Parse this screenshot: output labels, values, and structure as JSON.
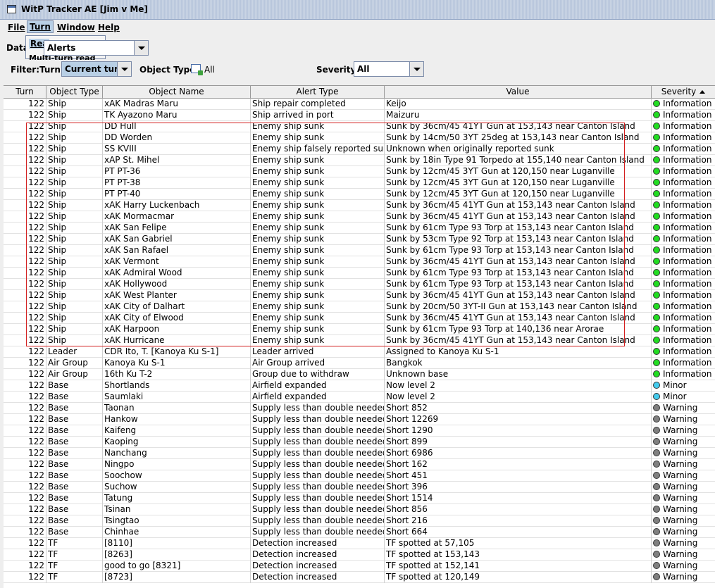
{
  "window": {
    "title": "WitP Tracker AE [Jim v Me]"
  },
  "menu": {
    "file": "File",
    "turn": "Turn",
    "window": "Window",
    "help": "Help"
  },
  "turn_menu": {
    "item1": "Rea",
    "item2": "Multi-turn read"
  },
  "toolbar": {
    "data_label": "Data",
    "data_value": "Alerts",
    "filter_label": "Filter:",
    "turn_label": "Turn:",
    "turn_value": "Current turn",
    "object_type_label": "Object Type:",
    "object_type_value": "All",
    "severity_label": "Severity:",
    "severity_value": "All"
  },
  "colors": {
    "information": "#22dd22",
    "minor": "#44ccee",
    "warning": "#808080",
    "highlight_box": "#d32020"
  },
  "table": {
    "columns": [
      "Turn",
      "Object Type",
      "Object Name",
      "Alert Type",
      "Value",
      "Severity"
    ],
    "rows": [
      {
        "turn": "122",
        "type": "Ship",
        "name": "xAK Madras Maru",
        "alert": "Ship repair completed",
        "value": "Keijo",
        "severity": "Information"
      },
      {
        "turn": "122",
        "type": "Ship",
        "name": "TK Ayazono Maru",
        "alert": "Ship arrived in port",
        "value": "Maizuru",
        "severity": "Information"
      },
      {
        "turn": "122",
        "type": "Ship",
        "name": "DD Hull",
        "alert": "Enemy ship sunk",
        "value": "Sunk by 36cm/45 41YT Gun at 153,143 near Canton Island",
        "severity": "Information"
      },
      {
        "turn": "122",
        "type": "Ship",
        "name": "DD Worden",
        "alert": "Enemy ship sunk",
        "value": "Sunk by 14cm/50 3YT 25deg at 153,143 near Canton Island",
        "severity": "Information"
      },
      {
        "turn": "122",
        "type": "Ship",
        "name": "SS KVIII",
        "alert": "Enemy ship falsely reported sunk",
        "value": "Unknown when originally reported sunk",
        "severity": "Information"
      },
      {
        "turn": "122",
        "type": "Ship",
        "name": "xAP St. Mihel",
        "alert": "Enemy ship sunk",
        "value": "Sunk by 18in Type 91 Torpedo at 155,140 near Canton Island",
        "severity": "Information"
      },
      {
        "turn": "122",
        "type": "Ship",
        "name": "PT PT-36",
        "alert": "Enemy ship sunk",
        "value": "Sunk by 12cm/45 3YT Gun at 120,150 near Luganville",
        "severity": "Information"
      },
      {
        "turn": "122",
        "type": "Ship",
        "name": "PT PT-38",
        "alert": "Enemy ship sunk",
        "value": "Sunk by 12cm/45 3YT Gun at 120,150 near Luganville",
        "severity": "Information"
      },
      {
        "turn": "122",
        "type": "Ship",
        "name": "PT PT-40",
        "alert": "Enemy ship sunk",
        "value": "Sunk by 12cm/45 3YT Gun at 120,150 near Luganville",
        "severity": "Information"
      },
      {
        "turn": "122",
        "type": "Ship",
        "name": "xAK Harry Luckenbach",
        "alert": "Enemy ship sunk",
        "value": "Sunk by 36cm/45 41YT Gun at 153,143 near Canton Island",
        "severity": "Information"
      },
      {
        "turn": "122",
        "type": "Ship",
        "name": "xAK Mormacmar",
        "alert": "Enemy ship sunk",
        "value": "Sunk by 36cm/45 41YT Gun at 153,143 near Canton Island",
        "severity": "Information"
      },
      {
        "turn": "122",
        "type": "Ship",
        "name": "xAK San Felipe",
        "alert": "Enemy ship sunk",
        "value": "Sunk by 61cm Type 93 Torp at 153,143 near Canton Island",
        "severity": "Information"
      },
      {
        "turn": "122",
        "type": "Ship",
        "name": "xAK San Gabriel",
        "alert": "Enemy ship sunk",
        "value": "Sunk by 53cm Type 92 Torp at 153,143 near Canton Island",
        "severity": "Information"
      },
      {
        "turn": "122",
        "type": "Ship",
        "name": "xAK San Rafael",
        "alert": "Enemy ship sunk",
        "value": "Sunk by 61cm Type 93 Torp at 153,143 near Canton Island",
        "severity": "Information"
      },
      {
        "turn": "122",
        "type": "Ship",
        "name": "xAK Vermont",
        "alert": "Enemy ship sunk",
        "value": "Sunk by 36cm/45 41YT Gun at 153,143 near Canton Island",
        "severity": "Information"
      },
      {
        "turn": "122",
        "type": "Ship",
        "name": "xAK Admiral Wood",
        "alert": "Enemy ship sunk",
        "value": "Sunk by 61cm Type 93 Torp at 153,143 near Canton Island",
        "severity": "Information"
      },
      {
        "turn": "122",
        "type": "Ship",
        "name": "xAK Hollywood",
        "alert": "Enemy ship sunk",
        "value": "Sunk by 61cm Type 93 Torp at 153,143 near Canton Island",
        "severity": "Information"
      },
      {
        "turn": "122",
        "type": "Ship",
        "name": "xAK West Planter",
        "alert": "Enemy ship sunk",
        "value": "Sunk by 36cm/45 41YT Gun at 153,143 near Canton Island",
        "severity": "Information"
      },
      {
        "turn": "122",
        "type": "Ship",
        "name": "xAK City of Dalhart",
        "alert": "Enemy ship sunk",
        "value": "Sunk by 20cm/50 3YT-II Gun at 153,143 near Canton Island",
        "severity": "Information"
      },
      {
        "turn": "122",
        "type": "Ship",
        "name": "xAK City of Elwood",
        "alert": "Enemy ship sunk",
        "value": "Sunk by 36cm/45 41YT Gun at 153,143 near Canton Island",
        "severity": "Information"
      },
      {
        "turn": "122",
        "type": "Ship",
        "name": "xAK Harpoon",
        "alert": "Enemy ship sunk",
        "value": "Sunk by 61cm Type 93 Torp at 140,136 near Arorae",
        "severity": "Information"
      },
      {
        "turn": "122",
        "type": "Ship",
        "name": "xAK Hurricane",
        "alert": "Enemy ship sunk",
        "value": "Sunk by 36cm/45 41YT Gun at 153,143 near Canton Island",
        "severity": "Information"
      },
      {
        "turn": "122",
        "type": "Leader",
        "name": "CDR Ito, T. [Kanoya Ku S-1]",
        "alert": "Leader arrived",
        "value": "Assigned to Kanoya Ku S-1",
        "severity": "Information"
      },
      {
        "turn": "122",
        "type": "Air Group",
        "name": "Kanoya Ku S-1",
        "alert": "Air Group arrived",
        "value": "Bangkok",
        "severity": "Information"
      },
      {
        "turn": "122",
        "type": "Air Group",
        "name": "16th Ku T-2",
        "alert": "Group due to withdraw",
        "value": "Unknown base",
        "severity": "Information"
      },
      {
        "turn": "122",
        "type": "Base",
        "name": "Shortlands",
        "alert": "Airfield expanded",
        "value": "Now level 2",
        "severity": "Minor"
      },
      {
        "turn": "122",
        "type": "Base",
        "name": "Saumlaki",
        "alert": "Airfield expanded",
        "value": "Now level 2",
        "severity": "Minor"
      },
      {
        "turn": "122",
        "type": "Base",
        "name": "Taonan",
        "alert": "Supply less than double needed",
        "value": "Short 852",
        "severity": "Warning"
      },
      {
        "turn": "122",
        "type": "Base",
        "name": "Hankow",
        "alert": "Supply less than double needed",
        "value": "Short 12269",
        "severity": "Warning"
      },
      {
        "turn": "122",
        "type": "Base",
        "name": "Kaifeng",
        "alert": "Supply less than double needed",
        "value": "Short 1290",
        "severity": "Warning"
      },
      {
        "turn": "122",
        "type": "Base",
        "name": "Kaoping",
        "alert": "Supply less than double needed",
        "value": "Short 899",
        "severity": "Warning"
      },
      {
        "turn": "122",
        "type": "Base",
        "name": "Nanchang",
        "alert": "Supply less than double needed",
        "value": "Short 6986",
        "severity": "Warning"
      },
      {
        "turn": "122",
        "type": "Base",
        "name": "Ningpo",
        "alert": "Supply less than double needed",
        "value": "Short 162",
        "severity": "Warning"
      },
      {
        "turn": "122",
        "type": "Base",
        "name": "Soochow",
        "alert": "Supply less than double needed",
        "value": "Short 451",
        "severity": "Warning"
      },
      {
        "turn": "122",
        "type": "Base",
        "name": "Suchow",
        "alert": "Supply less than double needed",
        "value": "Short 396",
        "severity": "Warning"
      },
      {
        "turn": "122",
        "type": "Base",
        "name": "Tatung",
        "alert": "Supply less than double needed",
        "value": "Short 1514",
        "severity": "Warning"
      },
      {
        "turn": "122",
        "type": "Base",
        "name": "Tsinan",
        "alert": "Supply less than double needed",
        "value": "Short 856",
        "severity": "Warning"
      },
      {
        "turn": "122",
        "type": "Base",
        "name": "Tsingtao",
        "alert": "Supply less than double needed",
        "value": "Short 216",
        "severity": "Warning"
      },
      {
        "turn": "122",
        "type": "Base",
        "name": "Chinhae",
        "alert": "Supply less than double needed",
        "value": "Short 664",
        "severity": "Warning"
      },
      {
        "turn": "122",
        "type": "TF",
        "name": "[8110]",
        "alert": "Detection increased",
        "value": "TF spotted at 57,105",
        "severity": "Warning"
      },
      {
        "turn": "122",
        "type": "TF",
        "name": "[8263]",
        "alert": "Detection increased",
        "value": "TF spotted at 153,143",
        "severity": "Warning"
      },
      {
        "turn": "122",
        "type": "TF",
        "name": "good to go [8321]",
        "alert": "Detection increased",
        "value": "TF spotted at 152,141",
        "severity": "Warning"
      },
      {
        "turn": "122",
        "type": "TF",
        "name": "[8723]",
        "alert": "Detection increased",
        "value": "TF spotted at 120,149",
        "severity": "Warning"
      }
    ]
  }
}
